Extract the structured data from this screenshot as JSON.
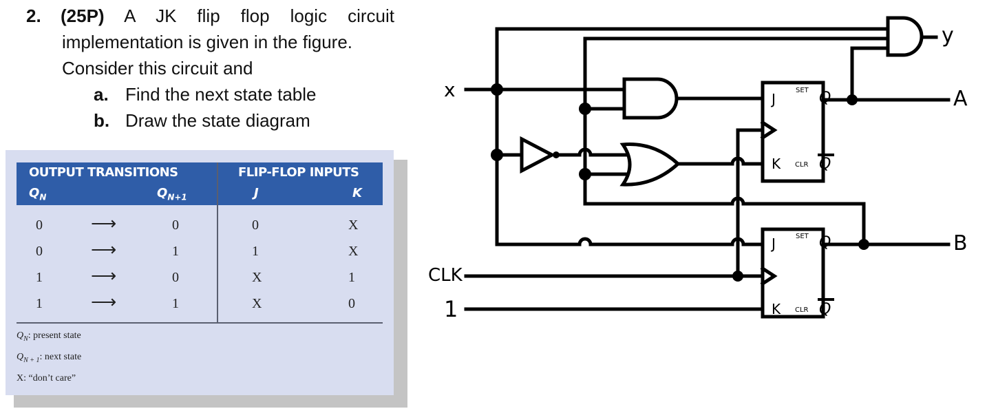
{
  "question": {
    "number": "2.",
    "points": "(25P)",
    "line1_rest": "A JK flip flop logic circuit",
    "line2": "implementation is given in the figure.",
    "line3": "Consider this circuit and",
    "parts": [
      {
        "letter": "a.",
        "text": "Find the next state table"
      },
      {
        "letter": "b.",
        "text": "Draw the state diagram"
      }
    ]
  },
  "excitation_table": {
    "group_headers": [
      "OUTPUT TRANSITIONS",
      "FLIP-FLOP INPUTS"
    ],
    "columns": {
      "qn": "Q",
      "qn_sub": "N",
      "qn1": "Q",
      "qn1_sub": "N+1",
      "j": "J",
      "k": "K"
    },
    "arrow": "⟶",
    "rows": [
      {
        "qn": "0",
        "qn1": "0",
        "j": "0",
        "k": "X"
      },
      {
        "qn": "0",
        "qn1": "1",
        "j": "1",
        "k": "X"
      },
      {
        "qn": "1",
        "qn1": "0",
        "j": "X",
        "k": "1"
      },
      {
        "qn": "1",
        "qn1": "1",
        "j": "X",
        "k": "0"
      }
    ],
    "notes": [
      {
        "sym": "Q",
        "sub": "N",
        "text": ": present state"
      },
      {
        "sym": "Q",
        "sub": "N + 1",
        "text": ": next state"
      },
      {
        "sym": "X",
        "sub": "",
        "text": ": “don’t care”"
      }
    ],
    "colors": {
      "header_bg": "#2f5da8",
      "panel_bg": "#d8ddf0"
    }
  },
  "circuit": {
    "inputs": [
      "x",
      "CLK",
      "1"
    ],
    "outputs": [
      "y",
      "A",
      "B"
    ],
    "flipflops": [
      {
        "name": "A",
        "pins": {
          "j": "J",
          "k": "K",
          "q": "Q",
          "qbar": "Q",
          "set": "SET",
          "clr": "CLR"
        }
      },
      {
        "name": "B",
        "pins": {
          "j": "J",
          "k": "K",
          "q": "Q",
          "qbar": "Q",
          "set": "SET",
          "clr": "CLR"
        }
      }
    ],
    "gates": [
      "AND (x, B) → J_A",
      "NOT x",
      "OR (x', B) → K_A",
      "AND (x, B, A) → y"
    ]
  }
}
